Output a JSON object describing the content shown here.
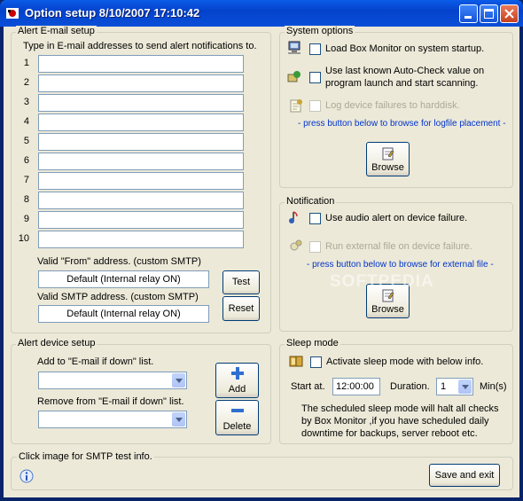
{
  "window": {
    "title": "Option setup 8/10/2007 17:10:42"
  },
  "alert_email": {
    "legend": "Alert E-mail setup",
    "instruction": "Type in E-mail addresses to send alert notifications to.",
    "rows": [
      {
        "num": "1",
        "value": ""
      },
      {
        "num": "2",
        "value": ""
      },
      {
        "num": "3",
        "value": ""
      },
      {
        "num": "4",
        "value": ""
      },
      {
        "num": "5",
        "value": ""
      },
      {
        "num": "6",
        "value": ""
      },
      {
        "num": "7",
        "value": ""
      },
      {
        "num": "8",
        "value": ""
      },
      {
        "num": "9",
        "value": ""
      },
      {
        "num": "10",
        "value": ""
      }
    ],
    "from_label": "Valid \"From\" address. (custom SMTP)",
    "from_value": "Default (Internal relay ON)",
    "smtp_label": "Valid SMTP address. (custom SMTP)",
    "smtp_value": "Default (Internal relay ON)",
    "test_label": "Test",
    "reset_label": "Reset"
  },
  "system_options": {
    "legend": "System options",
    "load_label": "Load Box Monitor on system startup.",
    "autocheck_line1": "Use last known Auto-Check value on",
    "autocheck_line2": "program launch and start scanning.",
    "log_label": "Log device failures to harddisk.",
    "log_hint": "- press button below to browse for logfile placement -",
    "browse_label": "Browse"
  },
  "notification": {
    "legend": "Notification",
    "audio_label": "Use audio alert on device failure.",
    "external_label": "Run external file on device failure.",
    "external_hint": "- press button below to browse for external file -",
    "browse_label": "Browse"
  },
  "device_setup": {
    "legend": "Alert device setup",
    "add_list_label": "Add to \"E-mail if down\" list.",
    "remove_list_label": "Remove from \"E-mail if down\" list.",
    "add_label": "Add",
    "delete_label": "Delete"
  },
  "sleep_mode": {
    "legend": "Sleep mode",
    "activate_label": "Activate sleep mode with below info.",
    "start_label": "Start at.",
    "start_value": "12:00:00",
    "duration_label": "Duration.",
    "duration_value": "1",
    "min_label": "Min(s)",
    "info_line1": "The scheduled sleep mode will halt all checks",
    "info_line2": "by Box Monitor ,if you have scheduled daily",
    "info_line3": "downtime for backups, server reboot etc."
  },
  "footer": {
    "smtp_info": "Click image for SMTP test info.",
    "save_label": "Save and exit"
  },
  "watermark": "SOFTPEDIA"
}
